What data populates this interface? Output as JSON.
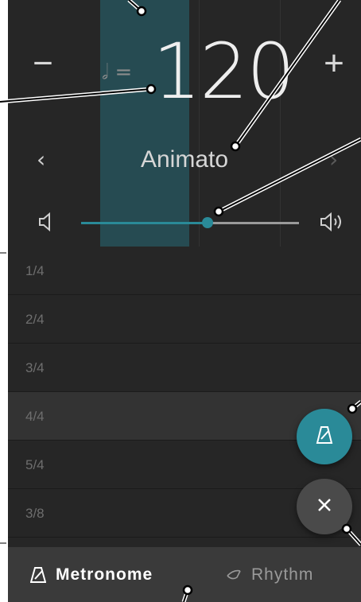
{
  "tempo": {
    "minus_label": "−",
    "plus_label": "+",
    "note_equals": "𝅗𝅥 =",
    "bpm": "120",
    "name": "Animato",
    "prev_label": "‹",
    "next_label": "›"
  },
  "volume": {
    "level_percent": 58
  },
  "time_signatures": [
    {
      "label": "1/4"
    },
    {
      "label": "2/4"
    },
    {
      "label": "3/4"
    },
    {
      "label": "4/4"
    },
    {
      "label": "5/4"
    },
    {
      "label": "3/8"
    }
  ],
  "selected_time_signature": "4/4",
  "tabs": {
    "metronome": "Metronome",
    "rhythm": "Rhythm"
  },
  "icons": {
    "volume_low": "speaker-low-icon",
    "volume_high": "speaker-high-icon",
    "metronome": "metronome-icon",
    "rhythm": "rhythm-icon",
    "close": "close-icon"
  },
  "colors": {
    "accent": "#2a8a98",
    "background": "#262626",
    "tabbar": "#3a3a3a"
  }
}
